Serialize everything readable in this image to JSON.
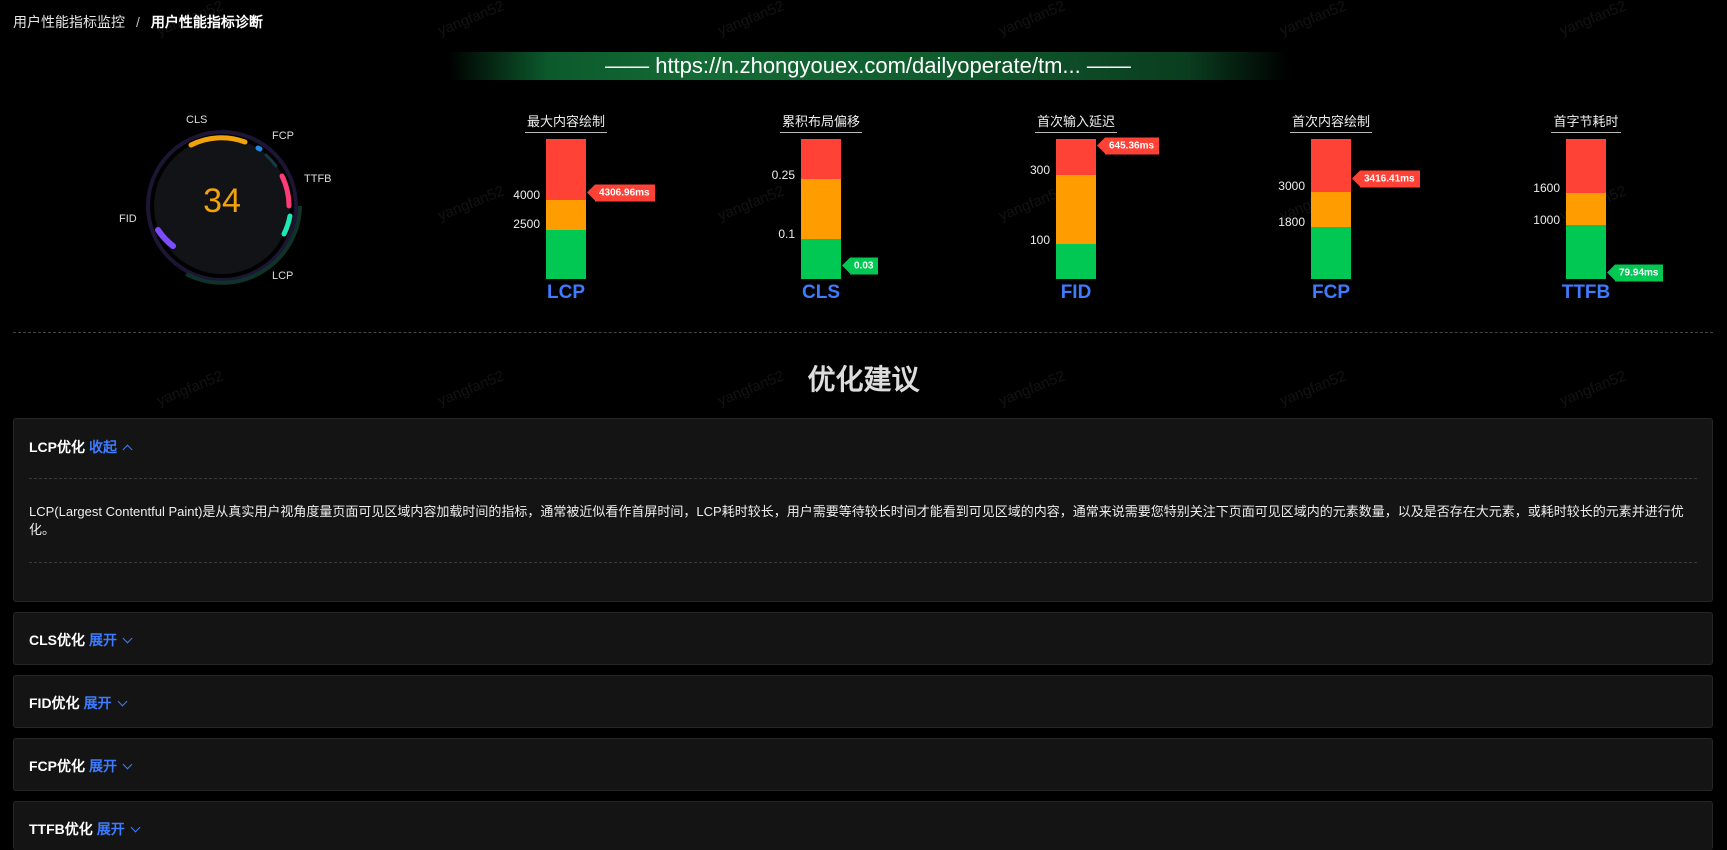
{
  "breadcrumb": {
    "parent": "用户性能指标监控",
    "separator": "/",
    "current": "用户性能指标诊断"
  },
  "url_banner": "—— https://n.zhongyouex.com/dailyoperate/tm... ——",
  "gauge": {
    "score": "34",
    "labels": {
      "cls": "CLS",
      "fcp": "FCP",
      "ttfb": "TTFB",
      "lcp": "LCP",
      "fid": "FID"
    },
    "colors": {
      "cls": "#f0a30a",
      "fcp": "#1e88e5",
      "ttfb": "#ff3c78",
      "lcp": "#1de9b6",
      "fid": "#7c4dff"
    }
  },
  "metrics": [
    {
      "title": "最大内容绘制",
      "name": "LCP",
      "ticks": [
        "4000",
        "2500"
      ],
      "value": "4306.96ms",
      "status": "bad"
    },
    {
      "title": "累积布局偏移",
      "name": "CLS",
      "ticks": [
        "0.25",
        "0.1"
      ],
      "value": "0.03",
      "status": "good"
    },
    {
      "title": "首次输入延迟",
      "name": "FID",
      "ticks": [
        "300",
        "100"
      ],
      "value": "645.36ms",
      "status": "bad"
    },
    {
      "title": "首次内容绘制",
      "name": "FCP",
      "ticks": [
        "3000",
        "1800"
      ],
      "value": "3416.41ms",
      "status": "bad"
    },
    {
      "title": "首字节耗时",
      "name": "TTFB",
      "ticks": [
        "1600",
        "1000"
      ],
      "value": "79.94ms",
      "status": "good"
    }
  ],
  "section_title": "优化建议",
  "panels": [
    {
      "title": "LCP优化",
      "toggle": "收起",
      "expanded": true,
      "body": "LCP(Largest Contentful Paint)是从真实用户视角度量页面可见区域内容加载时间的指标，通常被近似看作首屏时间，LCP耗时较长，用户需要等待较长时间才能看到可见区域的内容，通常来说需要您特别关注下页面可见区域内的元素数量，以及是否存在大元素，或耗时较长的元素并进行优化。"
    },
    {
      "title": "CLS优化",
      "toggle": "展开",
      "expanded": false
    },
    {
      "title": "FID优化",
      "toggle": "展开",
      "expanded": false
    },
    {
      "title": "FCP优化",
      "toggle": "展开",
      "expanded": false
    },
    {
      "title": "TTFB优化",
      "toggle": "展开",
      "expanded": false
    }
  ],
  "watermark": "yangfan52",
  "colors": {
    "bad": "#ff4136",
    "warn": "#ff9c00",
    "good": "#00c853",
    "accent": "#3d7bff",
    "score": "#f0a30a"
  }
}
